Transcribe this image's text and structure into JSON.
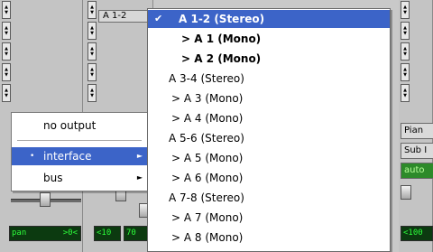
{
  "strips": {
    "center_io_label": "A 1-2",
    "left_pan_readout": "pan",
    "left_pan_value": ">0<",
    "mid_readout_left": "<10",
    "mid_readout_right": "70",
    "right_btn_1": "Pian",
    "right_btn_2": "Sub I",
    "right_btn_3": "auto",
    "right_readout": "<100"
  },
  "output_menu": {
    "items": [
      {
        "label": "no output"
      },
      {
        "label": "interface",
        "bullet": "•",
        "arrow": "►"
      },
      {
        "label": "bus",
        "arrow": "►"
      }
    ]
  },
  "channel_menu": {
    "check": "✔",
    "items": [
      {
        "label": "A 1-2 (Stereo)"
      },
      {
        "label": "> A 1 (Mono)"
      },
      {
        "label": "> A 2 (Mono)"
      },
      {
        "label": "A 3-4 (Stereo)"
      },
      {
        "label": "> A 3 (Mono)"
      },
      {
        "label": "> A 4 (Mono)"
      },
      {
        "label": "A 5-6 (Stereo)"
      },
      {
        "label": "> A 5 (Mono)"
      },
      {
        "label": "> A 6 (Mono)"
      },
      {
        "label": "A 7-8 (Stereo)"
      },
      {
        "label": "> A 7 (Mono)"
      },
      {
        "label": "> A 8 (Mono)"
      }
    ]
  },
  "colors": {
    "menu_highlight": "#3c64c8",
    "readout_text": "#2cff3a",
    "readout_bg": "#0c3a10"
  }
}
